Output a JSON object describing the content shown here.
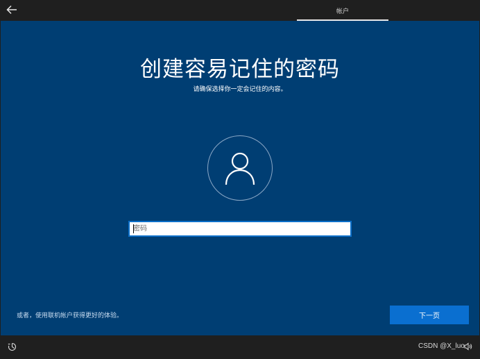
{
  "topbar": {
    "back_icon": "back-arrow-icon",
    "tab_label": "帐户"
  },
  "main": {
    "title": "创建容易记住的密码",
    "subtitle": "请确保选择你一定会记住的内容。",
    "avatar_icon": "user-icon",
    "password": {
      "value": "",
      "placeholder": "密码"
    },
    "alt_link": "或者，使用联机帐户获得更好的体验。",
    "next_label": "下一页"
  },
  "bottombar": {
    "ease_icon": "ease-of-access-icon",
    "watermark": "CSDN @X_luo",
    "volume_icon": "volume-icon"
  },
  "colors": {
    "panel_bg": "#003e73",
    "accent": "#0a6fd0",
    "chrome_bg": "#1f1f1f"
  }
}
